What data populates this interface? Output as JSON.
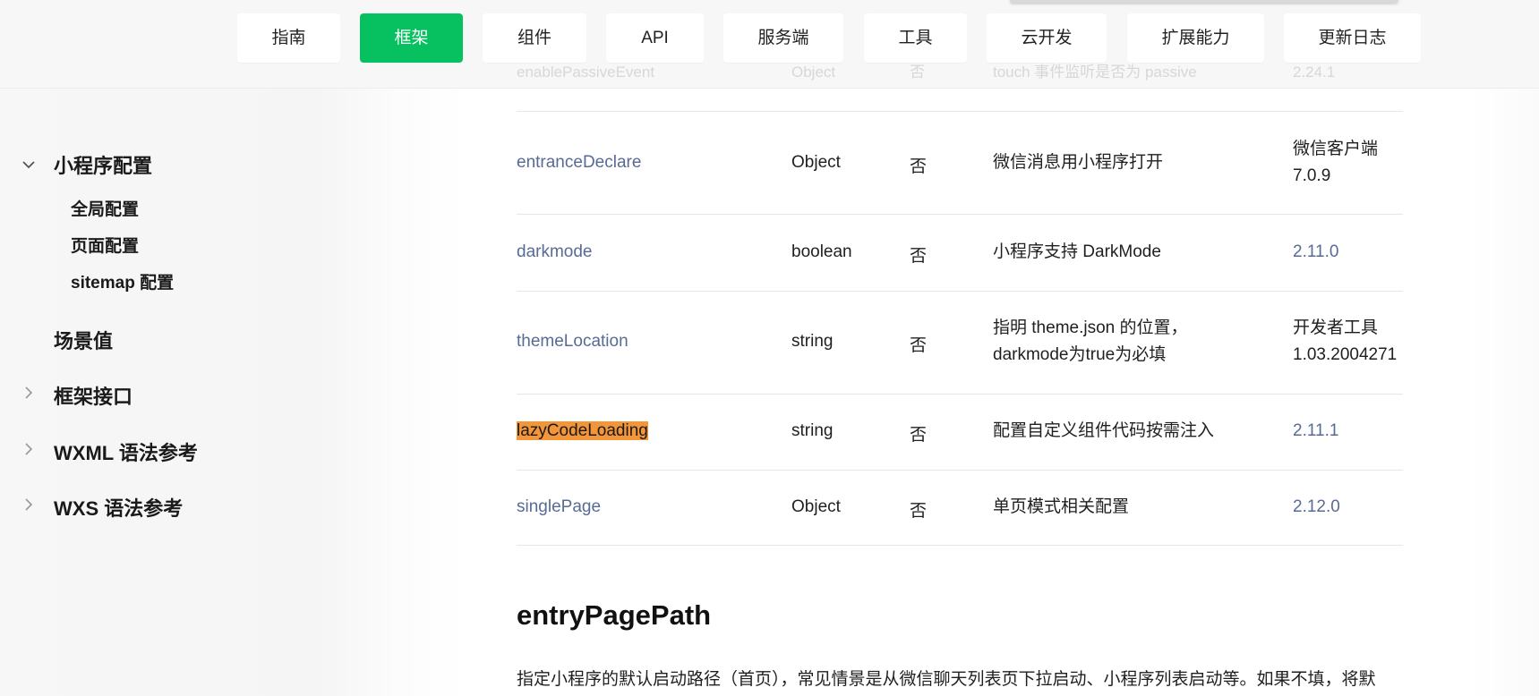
{
  "header": {
    "tabs": [
      {
        "label": "指南",
        "active": false
      },
      {
        "label": "框架",
        "active": true
      },
      {
        "label": "组件",
        "active": false
      },
      {
        "label": "API",
        "active": false
      },
      {
        "label": "服务端",
        "active": false
      },
      {
        "label": "工具",
        "active": false
      },
      {
        "label": "云开发",
        "active": false
      },
      {
        "label": "扩展能力",
        "active": false
      },
      {
        "label": "更新日志",
        "active": false
      }
    ],
    "accent_color": "#07c160",
    "ghost_row": {
      "attr": "enablePassiveEvent",
      "type": "Object",
      "required": "否",
      "desc": "touch 事件监听是否为 passive",
      "version": "2.24.1"
    }
  },
  "sidebar": {
    "sections": [
      {
        "label": "小程序配置",
        "expanded": true,
        "icon": "chevron-down-icon",
        "children": [
          "全局配置",
          "页面配置",
          "sitemap 配置"
        ]
      },
      {
        "label": "场景值",
        "expanded": false,
        "icon": ""
      },
      {
        "label": "框架接口",
        "expanded": false,
        "icon": "chevron-right-icon"
      },
      {
        "label": "WXML 语法参考",
        "expanded": false,
        "icon": "chevron-right-icon"
      },
      {
        "label": "WXS 语法参考",
        "expanded": false,
        "icon": "chevron-right-icon"
      }
    ]
  },
  "table": {
    "rows": [
      {
        "attr": "entranceDeclare",
        "type": "Object",
        "required": "否",
        "desc": [
          "微信消息用小程序打开"
        ],
        "version": [
          "微信客户端",
          "7.0.9"
        ],
        "version_is_link": false,
        "highlighted": false
      },
      {
        "attr": "darkmode",
        "type": "boolean",
        "required": "否",
        "desc": [
          "小程序支持 DarkMode"
        ],
        "version": [
          "2.11.0"
        ],
        "version_is_link": true,
        "highlighted": false
      },
      {
        "attr": "themeLocation",
        "type": "string",
        "required": "否",
        "desc": [
          "指明 theme.json 的位置，",
          "darkmode为true为必填"
        ],
        "version": [
          "开发者工具",
          "1.03.2004271"
        ],
        "version_is_link": false,
        "highlighted": false
      },
      {
        "attr": "lazyCodeLoading",
        "type": "string",
        "required": "否",
        "desc": [
          "配置自定义组件代码按需注入"
        ],
        "version": [
          "2.11.1"
        ],
        "version_is_link": true,
        "highlighted": true
      },
      {
        "attr": "singlePage",
        "type": "Object",
        "required": "否",
        "desc": [
          "单页模式相关配置"
        ],
        "version": [
          "2.12.0"
        ],
        "version_is_link": true,
        "highlighted": false
      }
    ],
    "link_color": "#576b95",
    "highlight_color": "#f3963a"
  },
  "section": {
    "title": "entryPagePath",
    "paragraph": "指定小程序的默认启动路径（首页），常见情景是从微信聊天列表页下拉启动、小程序列表启动等。如果不填，将默"
  }
}
